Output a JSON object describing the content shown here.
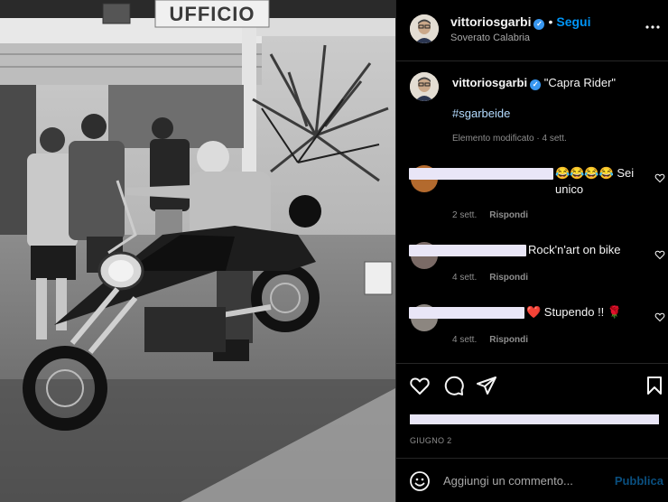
{
  "post": {
    "username": "vittoriosgarbi",
    "follow_label": "Segui",
    "location": "Soverato Calabria",
    "caption_text": "\"Capra Rider\"",
    "hashtag": "#sgarbeide",
    "edited_meta": "Elemento modificato · 4 sett.",
    "sign_text": "UFFICIO",
    "date": "GIUGNO 2"
  },
  "comments": [
    {
      "text": "😂😂😂😂 Sei unico",
      "time": "2 sett.",
      "reply": "Rispondi"
    },
    {
      "text": "Rock'n'art on bike",
      "time": "4 sett.",
      "reply": "Rispondi"
    },
    {
      "text": "❤️ Stupendo !! 🌹",
      "time": "4 sett.",
      "reply": "Rispondi"
    }
  ],
  "composer": {
    "placeholder": "Aggiungi un commento...",
    "publish_label": "Pubblica"
  },
  "icons": [
    "more-icon",
    "verified-badge",
    "heart-icon",
    "comment-icon",
    "share-icon",
    "bookmark-icon",
    "emoji-icon"
  ],
  "colors": {
    "background": "#000000",
    "link_blue": "#0095f6",
    "muted": "#8e8e8e",
    "divider": "#262626"
  }
}
